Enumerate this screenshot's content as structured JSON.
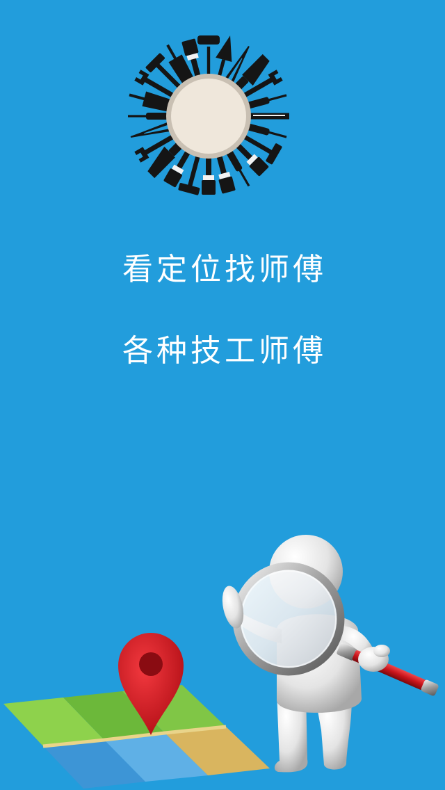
{
  "screen": {
    "background_color": "#229ddc",
    "taglines": [
      "看定位找师傅",
      "各种技工师傅"
    ]
  },
  "logo": {
    "icon": "tools-circle-icon",
    "plate_color": "#efe7db",
    "tool_color": "#151515"
  },
  "illustration": {
    "map_icon": "folded-map-icon",
    "pin_icon": "location-pin-icon",
    "figure_icon": "figure-with-magnifier-icon",
    "magnifier_icon": "magnifying-glass-icon",
    "pin_color": "#d9181f",
    "handle_color": "#c8141b"
  }
}
